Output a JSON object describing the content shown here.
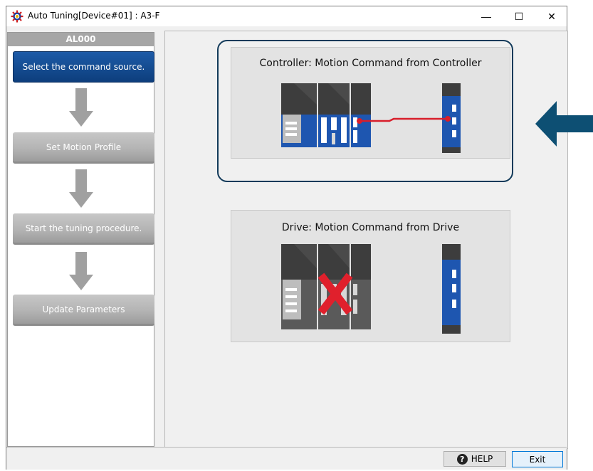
{
  "window": {
    "title": "Auto Tuning[Device#01] : A3-F",
    "controls": {
      "minimize": "—",
      "maximize": "☐",
      "close": "✕"
    }
  },
  "sidebar": {
    "alarm_code": "AL000",
    "steps": [
      {
        "label": "Select the command source.",
        "state": "active"
      },
      {
        "label": "Set Motion Profile",
        "state": "inactive"
      },
      {
        "label": "Start the tuning procedure.",
        "state": "inactive"
      },
      {
        "label": "Update Parameters",
        "state": "inactive"
      }
    ]
  },
  "options": {
    "controller": {
      "title": "Controller: Motion Command from Controller",
      "selected": true
    },
    "drive": {
      "title": "Drive: Motion Command from Drive",
      "selected": false
    }
  },
  "footer": {
    "help_label": "HELP",
    "exit_label": "Exit"
  },
  "colors": {
    "accent": "#0d3e7c",
    "highlight_border": "#123a5a",
    "pointer_arrow": "#0d4f73",
    "connector_red": "#d81e2b",
    "module_blue": "#1e56b0"
  },
  "icons": [
    "app-gear-icon",
    "help-icon",
    "down-arrow-icon",
    "left-pointer-arrow-icon"
  ]
}
